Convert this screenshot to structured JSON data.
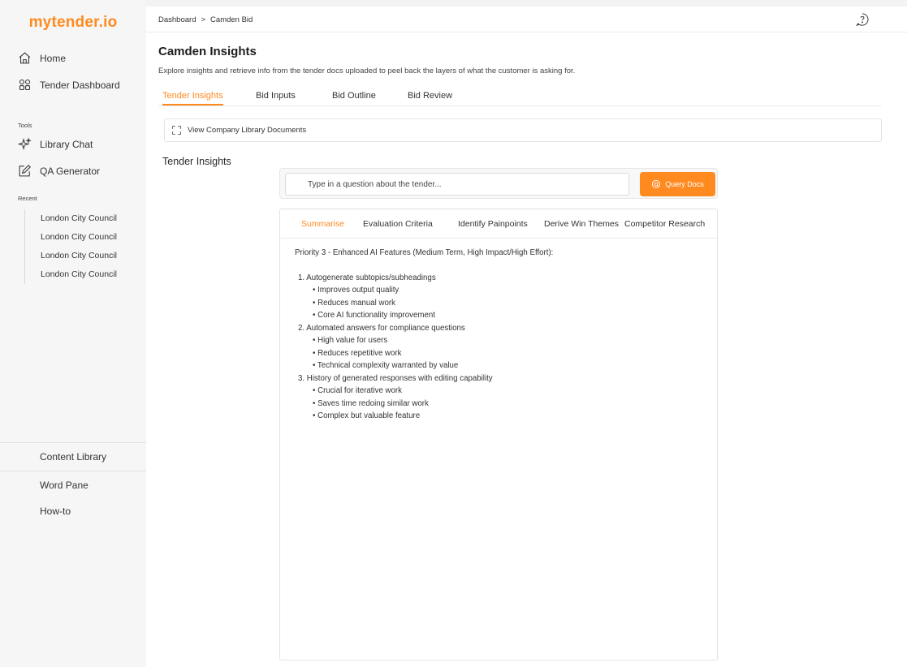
{
  "sidebar": {
    "logo": "mytender.io",
    "nav": [
      {
        "label": "Home",
        "icon": "home-icon"
      },
      {
        "label": "Tender Dashboard",
        "icon": "grid-icon"
      }
    ],
    "tools_label": "Tools",
    "tools": [
      {
        "label": "Library Chat",
        "icon": "sparkle-icon"
      },
      {
        "label": "QA Generator",
        "icon": "edit-icon"
      }
    ],
    "recent_label": "Recent",
    "recent": [
      "London City Council",
      "London City Council",
      "London City Council",
      "London City Council"
    ],
    "bottom": [
      "Content Library",
      "Word Pane",
      "How-to"
    ]
  },
  "header": {
    "breadcrumb": [
      "Dashboard",
      ">",
      "Camden Bid"
    ],
    "help_icon": "help-circle-icon"
  },
  "main": {
    "title": "Camden Insights",
    "subtitle": "Explore insights and retrieve info from the tender docs uploaded to peel back the layers of what the customer is asking for.",
    "tabs": [
      "Tender Insights",
      "Bid Inputs",
      "Bid Outline",
      "Bid Review"
    ],
    "active_tab": "Tender Insights",
    "library_button": "View Company Library Documents",
    "section_heading": "Tender Insights",
    "query": {
      "placeholder": "Type in a question about the tender...",
      "button_label": "Query Docs"
    },
    "result_tabs": [
      "Summarise",
      "Evaluation Criteria",
      "Identify Painpoints",
      "Derive Win Themes",
      "Competitor Research"
    ],
    "active_result_tab": "Summarise",
    "result": {
      "intro": "Priority 3 - Enhanced AI Features (Medium Term, High Impact/High Effort):",
      "items": [
        {
          "title": "1. Autogenerate subtopics/subheadings",
          "bullets": [
            "Improves output quality",
            "Reduces manual work",
            "Core AI functionality improvement"
          ]
        },
        {
          "title": "2. Automated answers for compliance questions",
          "bullets": [
            "High value for users",
            "Reduces repetitive work",
            "Technical complexity warranted by value"
          ]
        },
        {
          "title": "3. History of generated responses with editing capability",
          "bullets": [
            "Crucial for iterative work",
            "Saves time redoing similar work",
            "Complex but valuable feature"
          ]
        }
      ]
    }
  },
  "colors": {
    "accent": "#ff8a1f",
    "sidebar_bg": "#f6f6f6"
  }
}
